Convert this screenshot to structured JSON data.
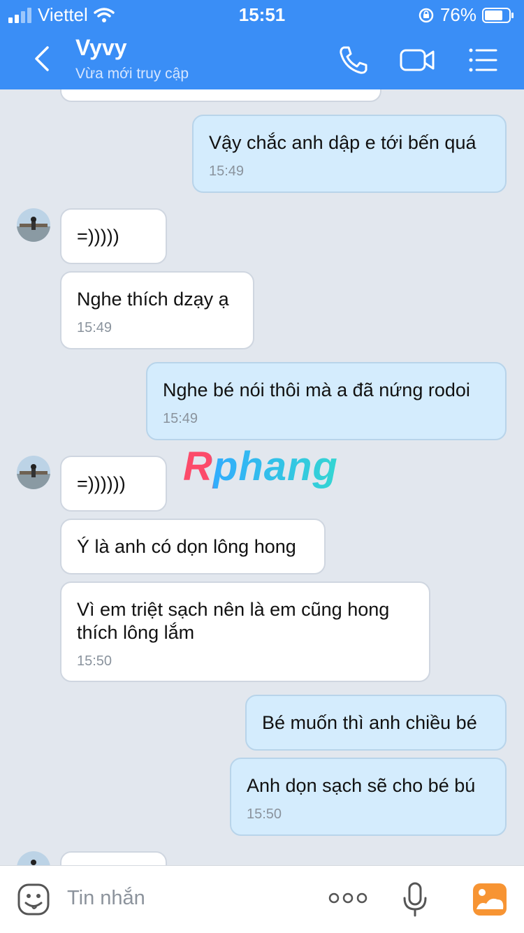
{
  "status": {
    "carrier": "Viettel",
    "time": "15:51",
    "battery": "76%"
  },
  "header": {
    "title": "Vyvy",
    "subtitle": "Vừa mới truy cập"
  },
  "messages": [
    {
      "dir": "out",
      "text": "Vậy chắc anh dập e tới bến quá",
      "time": "15:49"
    },
    {
      "dir": "in",
      "text": "=)))))",
      "time": ""
    },
    {
      "dir": "in",
      "text": "Nghe thích dzạy ạ",
      "time": "15:49"
    },
    {
      "dir": "out",
      "text": "Nghe bé nói thôi mà a đã nứng rodoi",
      "time": "15:49"
    },
    {
      "dir": "in",
      "text": "=))))))",
      "time": ""
    },
    {
      "dir": "in",
      "text": "Ý là anh có dọn lông hong",
      "time": ""
    },
    {
      "dir": "in",
      "text": "Vì em triệt sạch nên là em cũng hong thích lông lắm",
      "time": "15:50"
    },
    {
      "dir": "out",
      "text": "Bé muốn thì anh chiều bé",
      "time": ""
    },
    {
      "dir": "out",
      "text": "Anh dọn sạch sẽ cho bé bú",
      "time": "15:50"
    }
  ],
  "watermark": "Rphang",
  "composer": {
    "placeholder": "Tin nhắn"
  },
  "colors": {
    "header": "#3a8ef6",
    "outgoing": "#d4ecfd",
    "incoming": "#ffffff",
    "background": "#e2e7ee"
  }
}
